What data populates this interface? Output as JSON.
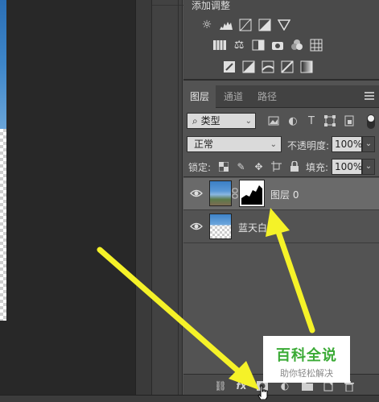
{
  "adjustments": {
    "title": "添加调整",
    "row1": [
      "brightness-icon",
      "levels-icon",
      "curves-icon",
      "exposure-icon",
      "gradient-triangle-icon"
    ],
    "row2": [
      "vibrance-icon",
      "balance-icon",
      "bw-icon",
      "photo-filter-icon",
      "channel-mixer-icon",
      "grid-lookup-icon"
    ],
    "row3": [
      "invert-icon",
      "posterize-icon",
      "threshold-icon",
      "selective-color-icon",
      "gradient-map-icon"
    ]
  },
  "tabs": [
    {
      "label": "图层",
      "active": true
    },
    {
      "label": "通道",
      "active": false
    },
    {
      "label": "路径",
      "active": false
    }
  ],
  "filter": {
    "kind_label": "类型"
  },
  "blend": {
    "mode": "正常",
    "opacity_label": "不透明度:",
    "opacity_value": "100%"
  },
  "lock": {
    "label": "锁定:",
    "fill_label": "填充:",
    "fill_value": "100%"
  },
  "layers": [
    {
      "name": "图层 0",
      "selected": true,
      "has_mask": true
    },
    {
      "name": "蓝天白",
      "selected": false,
      "has_mask": false
    }
  ],
  "bottom_bar": [
    "link-icon",
    "fx-icon",
    "add-mask-icon",
    "adjustment-layer-icon",
    "group-folder-icon",
    "new-layer-icon",
    "trash-icon"
  ],
  "watermark": {
    "title": "百科全说",
    "subtitle": "助你轻松解决"
  },
  "colors": {
    "highlight": "#f5f228",
    "panel": "#535353",
    "watermark_green": "#3aaa35"
  }
}
